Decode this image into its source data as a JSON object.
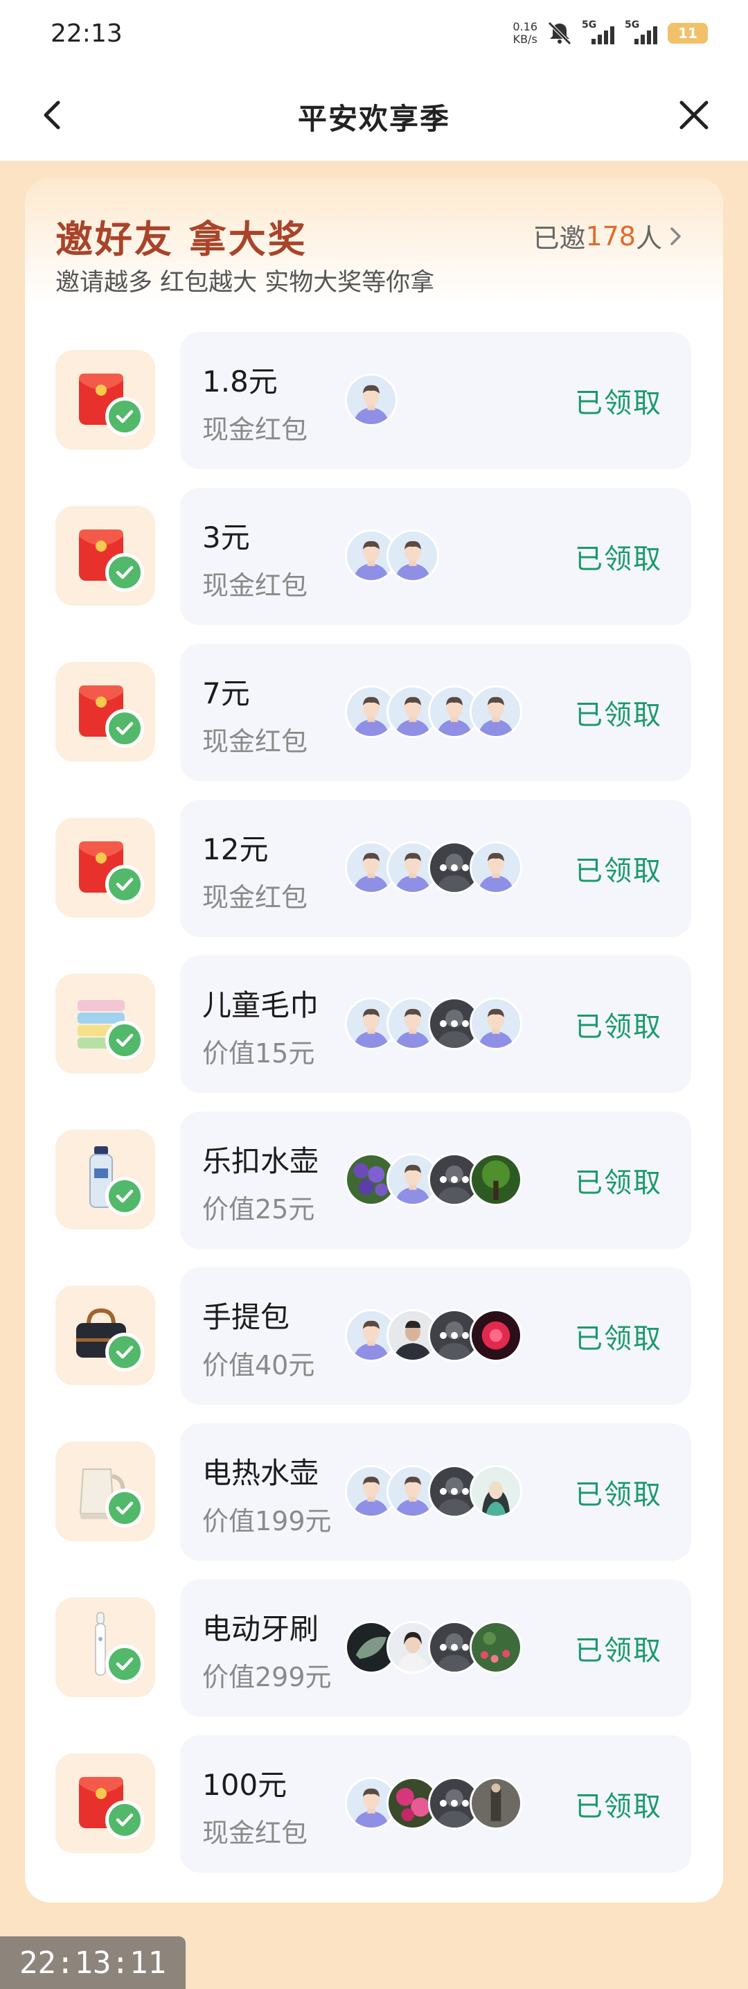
{
  "status_bar": {
    "time": "22:13",
    "net_speed_value": "0.16",
    "net_speed_unit": "KB/s",
    "signal_1_label": "5G",
    "signal_2_label": "5G",
    "battery": "11"
  },
  "nav": {
    "title": "平安欢享季"
  },
  "card": {
    "title": "邀好友 拿大奖",
    "subtitle": "邀请越多 红包越大 实物大奖等你拿",
    "invited_prefix": "已邀",
    "invited_count": "178",
    "invited_suffix": "人"
  },
  "rewards": [
    {
      "name": "1.8元",
      "desc": "现金红包",
      "status": "已领取",
      "icon": "red-envelope-icon",
      "avatars": [
        "default-avatar"
      ]
    },
    {
      "name": "3元",
      "desc": "现金红包",
      "status": "已领取",
      "icon": "red-envelope-icon",
      "avatars": [
        "default-avatar",
        "default-avatar"
      ]
    },
    {
      "name": "7元",
      "desc": "现金红包",
      "status": "已领取",
      "icon": "red-envelope-icon",
      "avatars": [
        "default-avatar",
        "default-avatar",
        "default-avatar",
        "default-avatar"
      ]
    },
    {
      "name": "12元",
      "desc": "现金红包",
      "status": "已领取",
      "icon": "red-envelope-icon",
      "avatars": [
        "default-avatar",
        "default-avatar",
        "photo-avatar-more",
        "default-avatar"
      ]
    },
    {
      "name": "儿童毛巾",
      "desc": "价值15元",
      "status": "已领取",
      "icon": "towel-stack-icon",
      "avatars": [
        "default-avatar",
        "default-avatar",
        "photo-avatar-more",
        "default-avatar"
      ]
    },
    {
      "name": "乐扣水壶",
      "desc": "价值25元",
      "status": "已领取",
      "icon": "water-bottle-icon",
      "avatars": [
        "flower-avatar",
        "default-avatar",
        "photo-avatar-more",
        "forest-avatar"
      ]
    },
    {
      "name": "手提包",
      "desc": "价值40元",
      "status": "已领取",
      "icon": "handbag-icon",
      "avatars": [
        "default-avatar",
        "man-photo-avatar",
        "photo-avatar-more",
        "red-flower-avatar"
      ]
    },
    {
      "name": "电热水壶",
      "desc": "价值199元",
      "status": "已领取",
      "icon": "electric-kettle-icon",
      "avatars": [
        "default-avatar",
        "default-avatar",
        "photo-avatar-more",
        "woman-cartoon-avatar"
      ]
    },
    {
      "name": "电动牙刷",
      "desc": "价值299元",
      "status": "已领取",
      "icon": "electric-toothbrush-icon",
      "avatars": [
        "leaf-avatar",
        "woman-photo-avatar",
        "photo-avatar-more",
        "garden-avatar"
      ]
    },
    {
      "name": "100元",
      "desc": "现金红包",
      "status": "已领取",
      "icon": "red-envelope-icon",
      "avatars": [
        "default-avatar",
        "pink-flower-avatar",
        "photo-avatar-more",
        "street-photo-avatar"
      ]
    }
  ],
  "screen_timestamp": "22:13:11",
  "colors": {
    "page_bg": "#fbe3c3",
    "title_brown": "#a8442a",
    "count_orange": "#e06b2f",
    "claimed_green": "#1a9a6a",
    "check_green": "#52b86a",
    "row_bg": "#f5f6fb"
  }
}
